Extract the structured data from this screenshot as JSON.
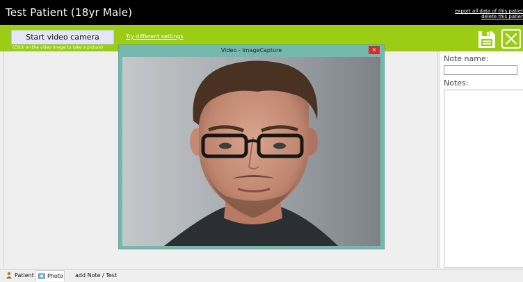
{
  "header": {
    "title": "Test Patient (18yr Male)",
    "link_export": "export all data of this patier",
    "link_delete": "delete this patier"
  },
  "toolbar": {
    "start_camera_label": "Start video camera",
    "hint": "(Click on the video image to take a picture)",
    "try_settings_label": "Try different settings",
    "save_icon": "save-icon",
    "close_icon": "close-icon",
    "accent_color": "#9acd14"
  },
  "video_window": {
    "title": "Video - ImageCapture",
    "close_glyph": "×"
  },
  "side_panel": {
    "note_name_label": "Note name:",
    "note_name_value": "",
    "notes_label": "Notes:",
    "notes_value": ""
  },
  "tabs": [
    {
      "label": "Patient",
      "icon": "patient-icon",
      "active": false
    },
    {
      "label": "Photo",
      "icon": "photo-icon",
      "active": true
    },
    {
      "label": "add Note / Test",
      "icon": "",
      "active": false
    }
  ]
}
